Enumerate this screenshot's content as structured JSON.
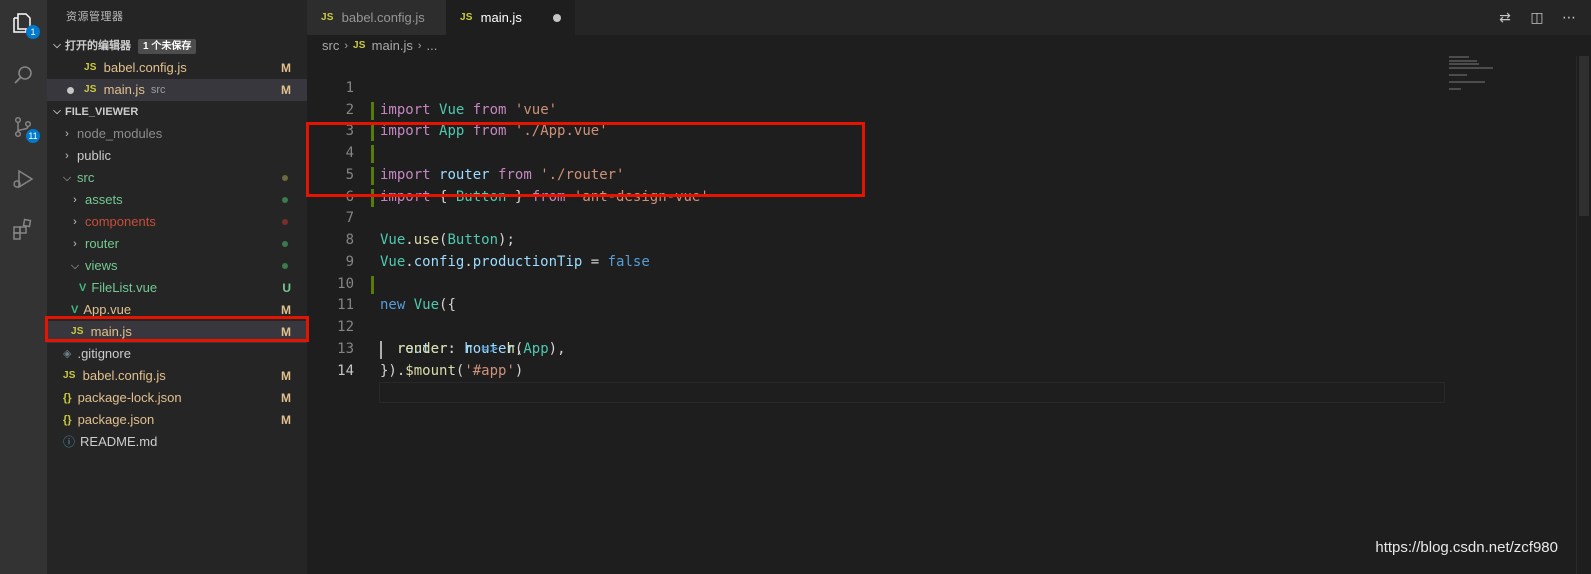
{
  "activity_bar": {
    "explorer_badge": "1",
    "scm_badge": "11"
  },
  "sidebar": {
    "title": "资源管理器",
    "open_editors": {
      "header": "打开的编辑器",
      "unsaved_badge": "1 个未保存",
      "items": [
        {
          "icon": "JS",
          "name": "babel.config.js",
          "desc": "",
          "status": "M"
        },
        {
          "icon": "JS",
          "name": "main.js",
          "desc": "src",
          "status": "M"
        }
      ]
    },
    "folder": {
      "header": "FILE_VIEWER",
      "items": [
        {
          "label": "node_modules",
          "status": ""
        },
        {
          "label": "public",
          "status": ""
        },
        {
          "label": "src",
          "status": ""
        },
        {
          "label": "assets",
          "status": ""
        },
        {
          "label": "components",
          "status": ""
        },
        {
          "label": "router",
          "status": ""
        },
        {
          "label": "views",
          "status": ""
        },
        {
          "label": "FileList.vue",
          "icon": "V",
          "status": "U"
        },
        {
          "label": "App.vue",
          "icon": "V",
          "status": "M"
        },
        {
          "label": "main.js",
          "icon": "JS",
          "status": "M"
        },
        {
          "label": ".gitignore",
          "icon": "◈",
          "status": ""
        },
        {
          "label": "babel.config.js",
          "icon": "JS",
          "status": "M"
        },
        {
          "label": "package-lock.json",
          "icon": "{}",
          "status": "M"
        },
        {
          "label": "package.json",
          "icon": "{}",
          "status": "M"
        },
        {
          "label": "README.md",
          "icon": "ⓘ",
          "status": ""
        }
      ]
    }
  },
  "tabs": [
    {
      "icon": "JS",
      "label": "babel.config.js"
    },
    {
      "icon": "JS",
      "label": "main.js"
    }
  ],
  "breadcrumb": {
    "folder": "src",
    "file": "main.js",
    "more": "..."
  },
  "code": {
    "line_numbers": [
      "1",
      "2",
      "3",
      "4",
      "5",
      "6",
      "7",
      "8",
      "9",
      "10",
      "11",
      "12",
      "13",
      "14"
    ],
    "tokens": {
      "kw_import": "import",
      "kw_from": "from",
      "kw_new": "new",
      "vue": "Vue",
      "app": "App",
      "router": "router",
      "button": "Button",
      "str_vue": "'vue'",
      "str_app": "'./App.vue'",
      "str_router": "'./router'",
      "str_antd": "'ant-design-vue'",
      "str_app_sel": "'#app'",
      "use": "use",
      "config": "config",
      "productionTip": "productionTip",
      "false": "false",
      "router_key": "router",
      "render": "render",
      "h": "h",
      "arrow": "=>",
      "mount": "$mount"
    }
  },
  "watermark": "https://blog.csdn.net/zcf980",
  "colors": {
    "accent": "#007acc",
    "highlight_box": "#e51400",
    "git_modified": "#e2c08d",
    "git_untracked": "#73c991"
  }
}
